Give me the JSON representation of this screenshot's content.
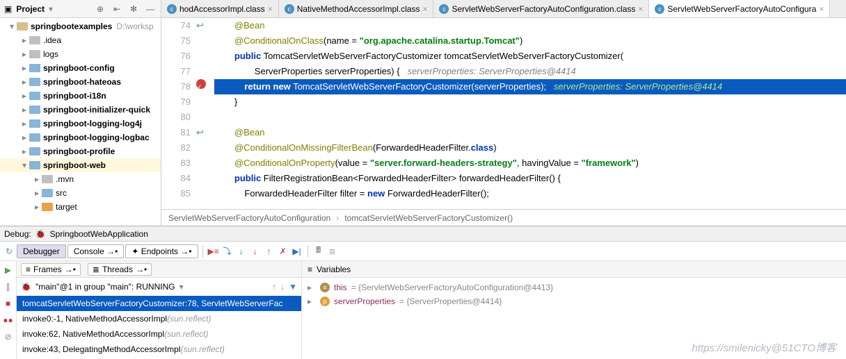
{
  "project": {
    "title": "Project",
    "root": {
      "name": "springbootexamples",
      "hint": "D:\\worksp"
    },
    "items": [
      {
        "name": ".idea",
        "level": 2,
        "type": "gray",
        "expandable": true
      },
      {
        "name": "logs",
        "level": 2,
        "type": "gray",
        "expandable": true
      },
      {
        "name": "springboot-config",
        "level": 2,
        "type": "blue",
        "expandable": true,
        "bold": true
      },
      {
        "name": "springboot-hateoas",
        "level": 2,
        "type": "blue",
        "expandable": true,
        "bold": true
      },
      {
        "name": "springboot-i18n",
        "level": 2,
        "type": "blue",
        "expandable": true,
        "bold": true
      },
      {
        "name": "springboot-initializer-quick",
        "level": 2,
        "type": "blue",
        "expandable": true,
        "bold": true
      },
      {
        "name": "springboot-logging-log4j",
        "level": 2,
        "type": "blue",
        "expandable": true,
        "bold": true
      },
      {
        "name": "springboot-logging-logbac",
        "level": 2,
        "type": "blue",
        "expandable": true,
        "bold": true
      },
      {
        "name": "springboot-profile",
        "level": 2,
        "type": "blue",
        "expandable": true,
        "bold": true
      },
      {
        "name": "springboot-web",
        "level": 2,
        "type": "blue",
        "expandable": true,
        "bold": true,
        "expanded": true,
        "selected": true
      },
      {
        "name": ".mvn",
        "level": 3,
        "type": "gray",
        "expandable": true
      },
      {
        "name": "src",
        "level": 3,
        "type": "blue",
        "expandable": true
      },
      {
        "name": "target",
        "level": 3,
        "type": "orange",
        "expandable": true
      }
    ]
  },
  "tabs": [
    {
      "label": "hodAccessorImpl.class",
      "active": false
    },
    {
      "label": "NativeMethodAccessorImpl.class",
      "active": false
    },
    {
      "label": "ServletWebServerFactoryAutoConfiguration.class",
      "active": false
    },
    {
      "label": "ServletWebServerFactoryAutoConfigura",
      "active": true
    }
  ],
  "code": {
    "lines": [
      {
        "n": 74,
        "anno": "ret",
        "html": "        <span class='anno-kw'>@Bean</span>"
      },
      {
        "n": 75,
        "html": "        <span class='anno-kw'>@ConditionalOnClass</span>(name = <span class='str'>\"org.apache.catalina.startup.Tomcat\"</span>)"
      },
      {
        "n": 76,
        "html": "        <span class='kw'>public</span> TomcatServletWebServerFactoryCustomizer tomcatServletWebServerFactoryCustomizer("
      },
      {
        "n": 77,
        "html": "                ServerProperties serverProperties) {   <span class='cm'>serverProperties: ServerProperties@4414</span>"
      },
      {
        "n": 78,
        "anno": "bp",
        "hl": true,
        "html": "            <span class='kw'>return new</span> TomcatServletWebServerFactoryCustomizer(serverProperties);   <span class='cm2'>serverProperties: ServerProperties@4414</span>"
      },
      {
        "n": 79,
        "html": "        }"
      },
      {
        "n": 80,
        "html": ""
      },
      {
        "n": 81,
        "anno": "ret",
        "html": "        <span class='anno-kw'>@Bean</span>"
      },
      {
        "n": 82,
        "html": "        <span class='anno-kw'>@ConditionalOnMissingFilterBean</span>(ForwardedHeaderFilter.<span class='kw'>class</span>)"
      },
      {
        "n": 83,
        "html": "        <span class='anno-kw'>@ConditionalOnProperty</span>(value = <span class='str'>\"server.forward-headers-strategy\"</span>, havingValue = <span class='str'>\"framework\"</span>)"
      },
      {
        "n": 84,
        "html": "        <span class='kw'>public</span> FilterRegistrationBean&lt;ForwardedHeaderFilter&gt; forwardedHeaderFilter() {"
      },
      {
        "n": 85,
        "html": "            ForwardedHeaderFilter filter = <span class='kw'>new</span> ForwardedHeaderFilter();"
      }
    ]
  },
  "breadcrumb": {
    "class": "ServletWebServerFactoryAutoConfiguration",
    "method": "tomcatServletWebServerFactoryCustomizer()"
  },
  "debug": {
    "label": "Debug:",
    "config": "SpringbootWebApplication",
    "tabs": {
      "debugger": "Debugger",
      "console": "Console",
      "endpoints": "Endpoints"
    },
    "frames": {
      "frames_label": "Frames",
      "threads_label": "Threads",
      "thread": "\"main\"@1 in group \"main\": RUNNING",
      "stack": [
        {
          "text": "tomcatServletWebServerFactoryCustomizer:78, ServletWebServerFac",
          "selected": true
        },
        {
          "text": "invoke0:-1, NativeMethodAccessorImpl ",
          "pkg": "(sun.reflect)"
        },
        {
          "text": "invoke:62, NativeMethodAccessorImpl ",
          "pkg": "(sun.reflect)"
        },
        {
          "text": "invoke:43, DelegatingMethodAccessorImpl ",
          "pkg": "(sun.reflect)"
        }
      ]
    },
    "vars": {
      "label": "Variables",
      "items": [
        {
          "icon": "this",
          "name": "this",
          "eq": " = ",
          "val": "{ServletWebServerFactoryAutoConfiguration@4413}",
          "expandable": true
        },
        {
          "icon": "p",
          "name": "serverProperties",
          "eq": " = ",
          "val": "{ServerProperties@4414}",
          "expandable": true
        }
      ]
    }
  },
  "watermark": "https://smilenicky@51CTO博客"
}
